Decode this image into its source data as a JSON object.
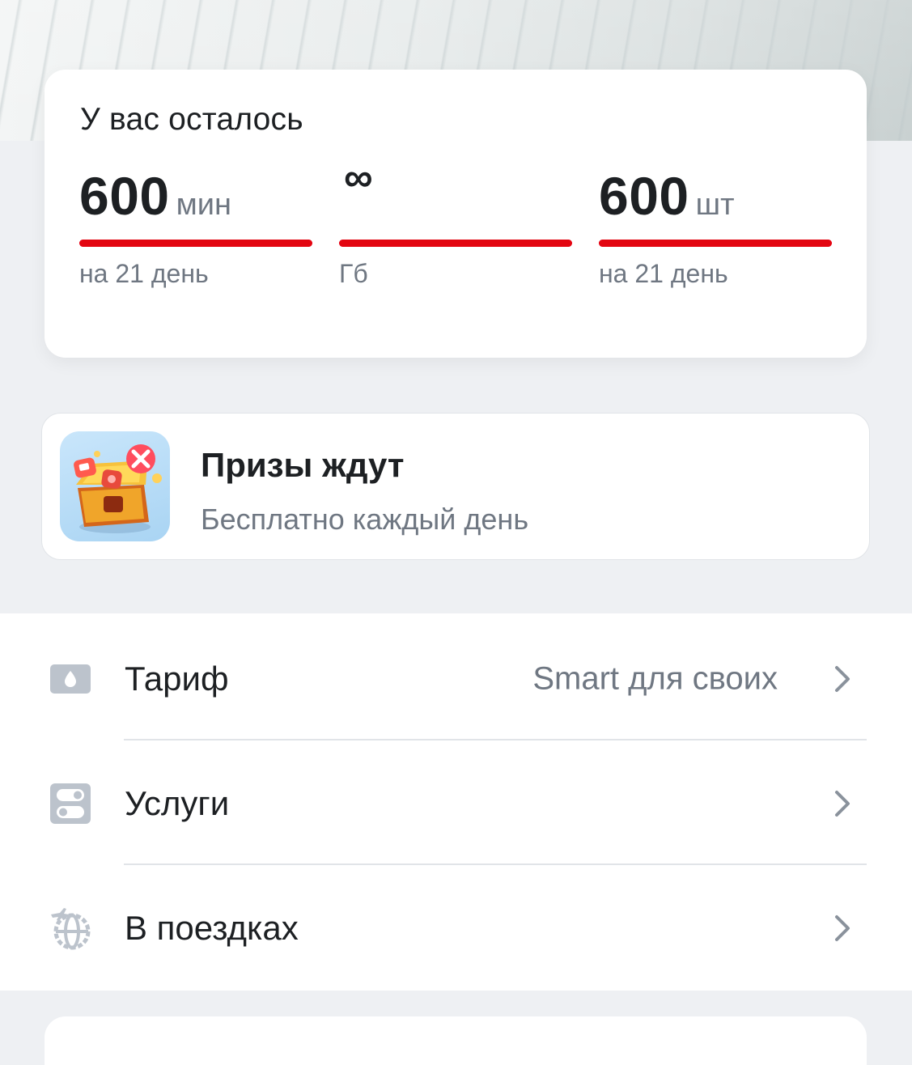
{
  "balance": {
    "title": "У вас осталось",
    "counters": [
      {
        "value": "600",
        "unit": "мин",
        "caption": "на 21 день",
        "progress": 1.0
      },
      {
        "value": "∞",
        "unit": "",
        "caption": "Гб",
        "progress": 1.0
      },
      {
        "value": "600",
        "unit": "шт",
        "caption": "на 21 день",
        "progress": 1.0
      }
    ]
  },
  "promo": {
    "title": "Призы ждут",
    "subtitle": "Бесплатно каждый день",
    "icon": "treasure-chest-icon"
  },
  "menu": {
    "items": [
      {
        "label": "Тариф",
        "value": "Smart для своих",
        "icon": "sim-card-icon"
      },
      {
        "label": "Услуги",
        "value": "",
        "icon": "toggles-icon"
      },
      {
        "label": "В поездках",
        "value": "",
        "icon": "travel-globe-icon"
      }
    ]
  },
  "colors": {
    "accent": "#e30611",
    "page_bg": "#eef0f3",
    "text_primary": "#1d2023",
    "text_secondary": "#6f7782",
    "icon_gray": "#bcc3cc"
  }
}
